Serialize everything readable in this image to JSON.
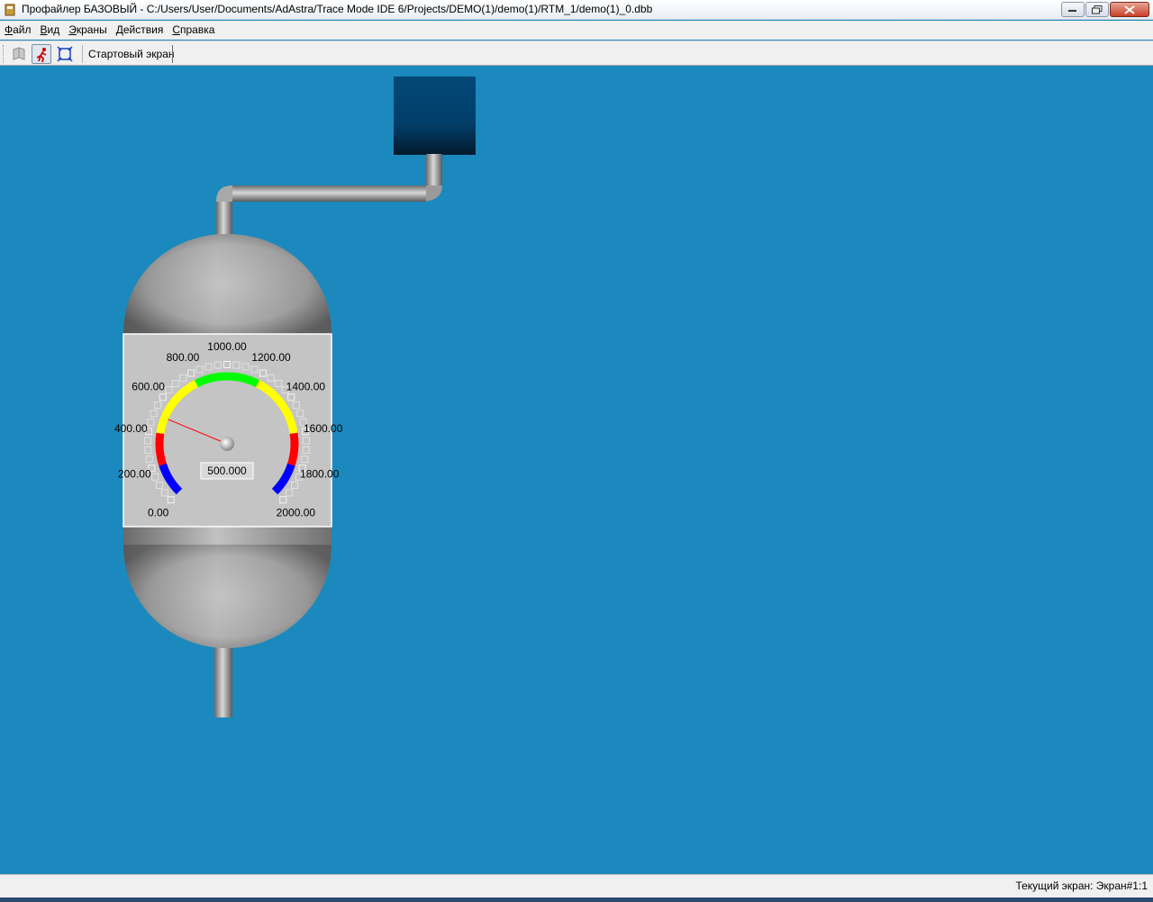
{
  "window": {
    "title": "Профайлер БАЗОВЫЙ - C:/Users/User/Documents/AdAstra/Trace Mode IDE 6/Projects/DEMO(1)/demo(1)/RTM_1/demo(1)_0.dbb"
  },
  "menu": [
    {
      "first": "Ф",
      "rest": "айл"
    },
    {
      "first": "В",
      "rest": "ид"
    },
    {
      "first": "Э",
      "rest": "краны"
    },
    {
      "first": "Д",
      "rest": "ействия"
    },
    {
      "first": "С",
      "rest": "правка"
    }
  ],
  "toolbar": {
    "screen_label": "Стартовый экран"
  },
  "gauge": {
    "value": 500,
    "value_text": "500.000",
    "min": 0,
    "max": 2000,
    "tick_labels": [
      "0.00",
      "200.00",
      "400.00",
      "600.00",
      "800.00",
      "1000.00",
      "1200.00",
      "1400.00",
      "1600.00",
      "1800.00",
      "2000.00"
    ],
    "zones": [
      {
        "from": 0,
        "to": 200,
        "color": "#0000ff"
      },
      {
        "from": 200,
        "to": 400,
        "color": "#ff0000"
      },
      {
        "from": 400,
        "to": 800,
        "color": "#ffff00"
      },
      {
        "from": 800,
        "to": 1200,
        "color": "#00ff00"
      },
      {
        "from": 1200,
        "to": 1600,
        "color": "#ffff00"
      },
      {
        "from": 1600,
        "to": 1800,
        "color": "#ff0000"
      },
      {
        "from": 1800,
        "to": 2000,
        "color": "#0000ff"
      }
    ],
    "needle_color": "#ff0000"
  },
  "status": {
    "current_screen": "Текущий экран: Экран#1:1"
  },
  "colors": {
    "canvas": "#1b89bd",
    "tank_box": "#034877"
  }
}
